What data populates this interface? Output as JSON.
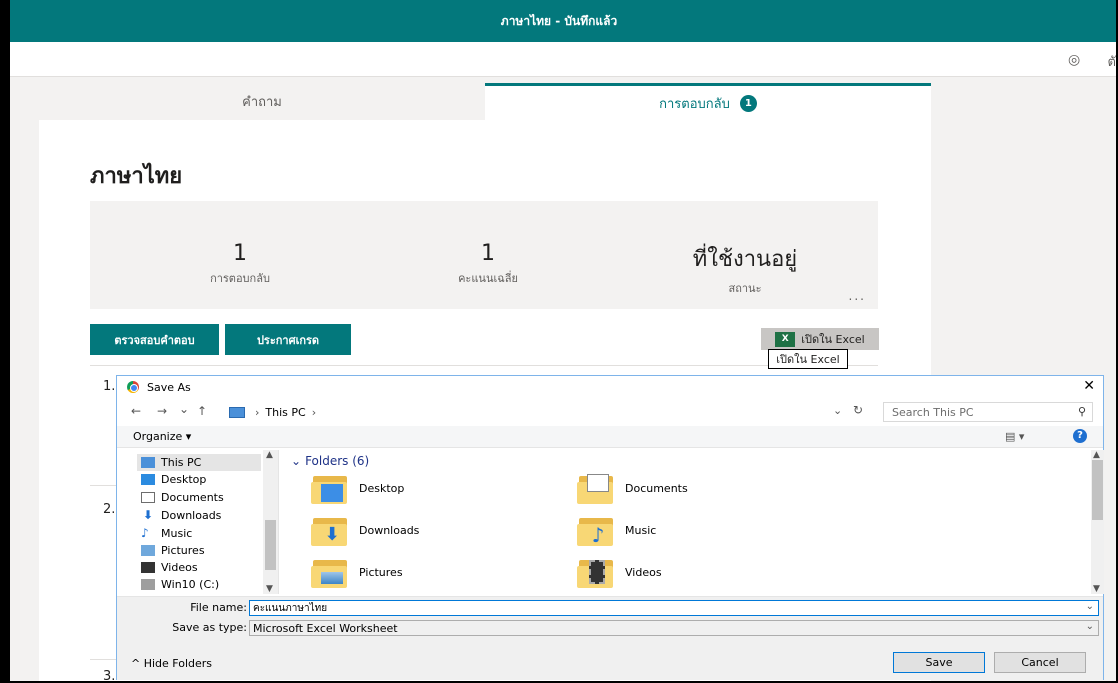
{
  "window": {
    "title": "ภาษาไทย - บันทึกแล้ว",
    "topbar_text": "ตั"
  },
  "tabs": [
    {
      "label": "คำถาม"
    },
    {
      "label": "การตอบกลับ",
      "badge": "1"
    }
  ],
  "form_title": "ภาษาไทย",
  "stats": [
    {
      "value": "1",
      "label": "การตอบกลับ"
    },
    {
      "value": "1",
      "label": "คะแนนเฉลี่ย"
    },
    {
      "value": "ที่ใช้งานอยู่",
      "label": "สถานะ"
    }
  ],
  "more_label": "...",
  "buttons": {
    "review": "ตรวจสอบคำตอบ",
    "grades": "ประกาศเกรด",
    "excel": "เปิดใน Excel",
    "excel_icon": "X",
    "tooltip": "เปิดใน Excel"
  },
  "questions": [
    "1.",
    "2.",
    "3."
  ],
  "dialog": {
    "title": "Save As",
    "close": "✕",
    "nav": {
      "back": "←",
      "forward": "→",
      "dropdown": "⌄",
      "up": "↑"
    },
    "address": "This PC",
    "search_placeholder": "Search This PC",
    "organize": "Organize ▾",
    "help": "?",
    "nav_pane": [
      {
        "label": "This PC",
        "icon": "pc-icon"
      },
      {
        "label": "Desktop",
        "icon": "desktop-icon"
      },
      {
        "label": "Documents",
        "icon": "documents-icon"
      },
      {
        "label": "Downloads",
        "icon": "downloads-icon"
      },
      {
        "label": "Music",
        "icon": "music-icon"
      },
      {
        "label": "Pictures",
        "icon": "pictures-icon"
      },
      {
        "label": "Videos",
        "icon": "videos-icon"
      },
      {
        "label": "Win10 (C:)",
        "icon": "drive-icon"
      }
    ],
    "folders_header": "Folders (6)",
    "folders": [
      {
        "label": "Desktop",
        "icon": "desktop-folder-icon"
      },
      {
        "label": "Documents",
        "icon": "documents-folder-icon"
      },
      {
        "label": "Downloads",
        "icon": "downloads-folder-icon"
      },
      {
        "label": "Music",
        "icon": "music-folder-icon"
      },
      {
        "label": "Pictures",
        "icon": "pictures-folder-icon"
      },
      {
        "label": "Videos",
        "icon": "videos-folder-icon"
      }
    ],
    "file_name_label": "File name:",
    "file_name_value": "คะแนนภาษาไทย",
    "save_type_label": "Save as type:",
    "save_type_value": "Microsoft Excel Worksheet",
    "hide_folders": "Hide Folders",
    "save": "Save",
    "cancel": "Cancel"
  },
  "colors": {
    "accent": "#03787c",
    "excel_green": "#1e7145",
    "dialog_border": "#7eb4ea"
  }
}
